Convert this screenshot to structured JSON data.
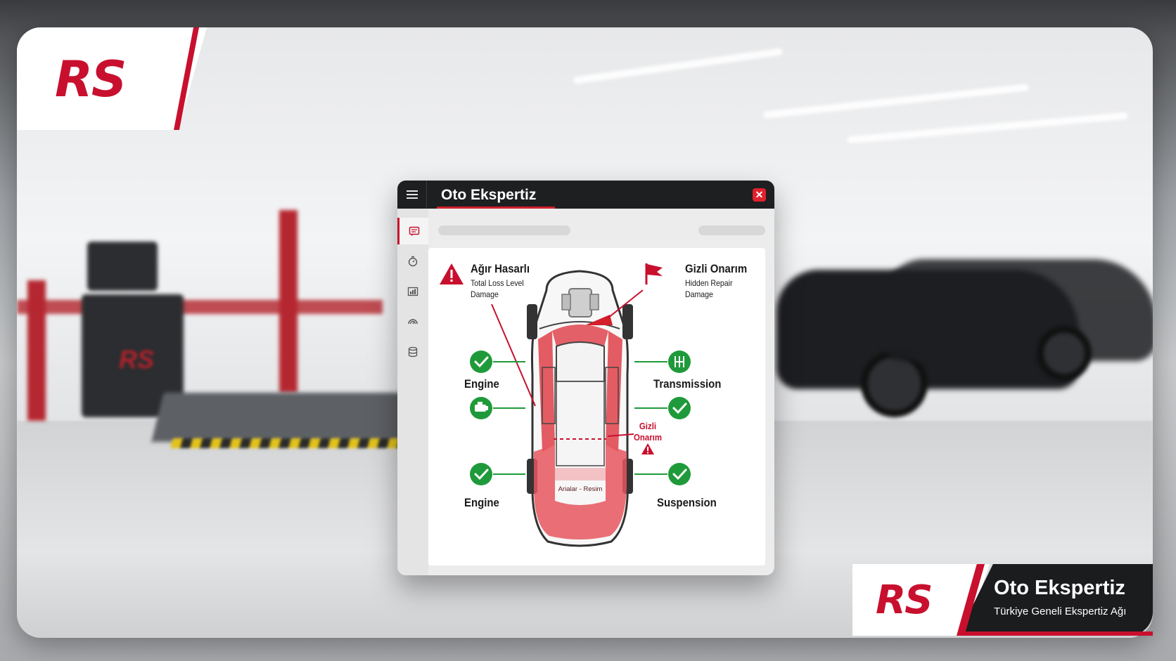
{
  "logo": {
    "text": "RS"
  },
  "machine_logo": {
    "text": "RS"
  },
  "window": {
    "title": "Oto Ekspertiz",
    "close_glyph": "✕",
    "sidebar_icons": [
      "report-icon",
      "stopwatch-icon",
      "chart-icon",
      "gauge-icon",
      "database-icon"
    ]
  },
  "diagram": {
    "heavy_damage": {
      "title": "Ağır Hasarlı",
      "subtitle_line1": "Total Loss Level",
      "subtitle_line2": "Damage"
    },
    "hidden_repair": {
      "title": "Gizli Onarım",
      "subtitle_line1": "Hidden Repair",
      "subtitle_line2": "Damage"
    },
    "items": {
      "engine_top": "Engine",
      "transmission": "Transmission",
      "engine_bottom": "Engine",
      "suspension": "Suspension"
    },
    "mid_note_line1": "Gizli",
    "mid_note_line2": "Onarım",
    "car_label": "Arialar - Resim"
  },
  "brand": {
    "logo_text": "RS",
    "title": "Oto Ekspertiz",
    "subtitle": "Türkiye Geneli Ekspertiz Ağı"
  },
  "colors": {
    "accent_red": "#c8102e",
    "check_green": "#1f9a3a",
    "titlebar": "#1e1f21"
  }
}
